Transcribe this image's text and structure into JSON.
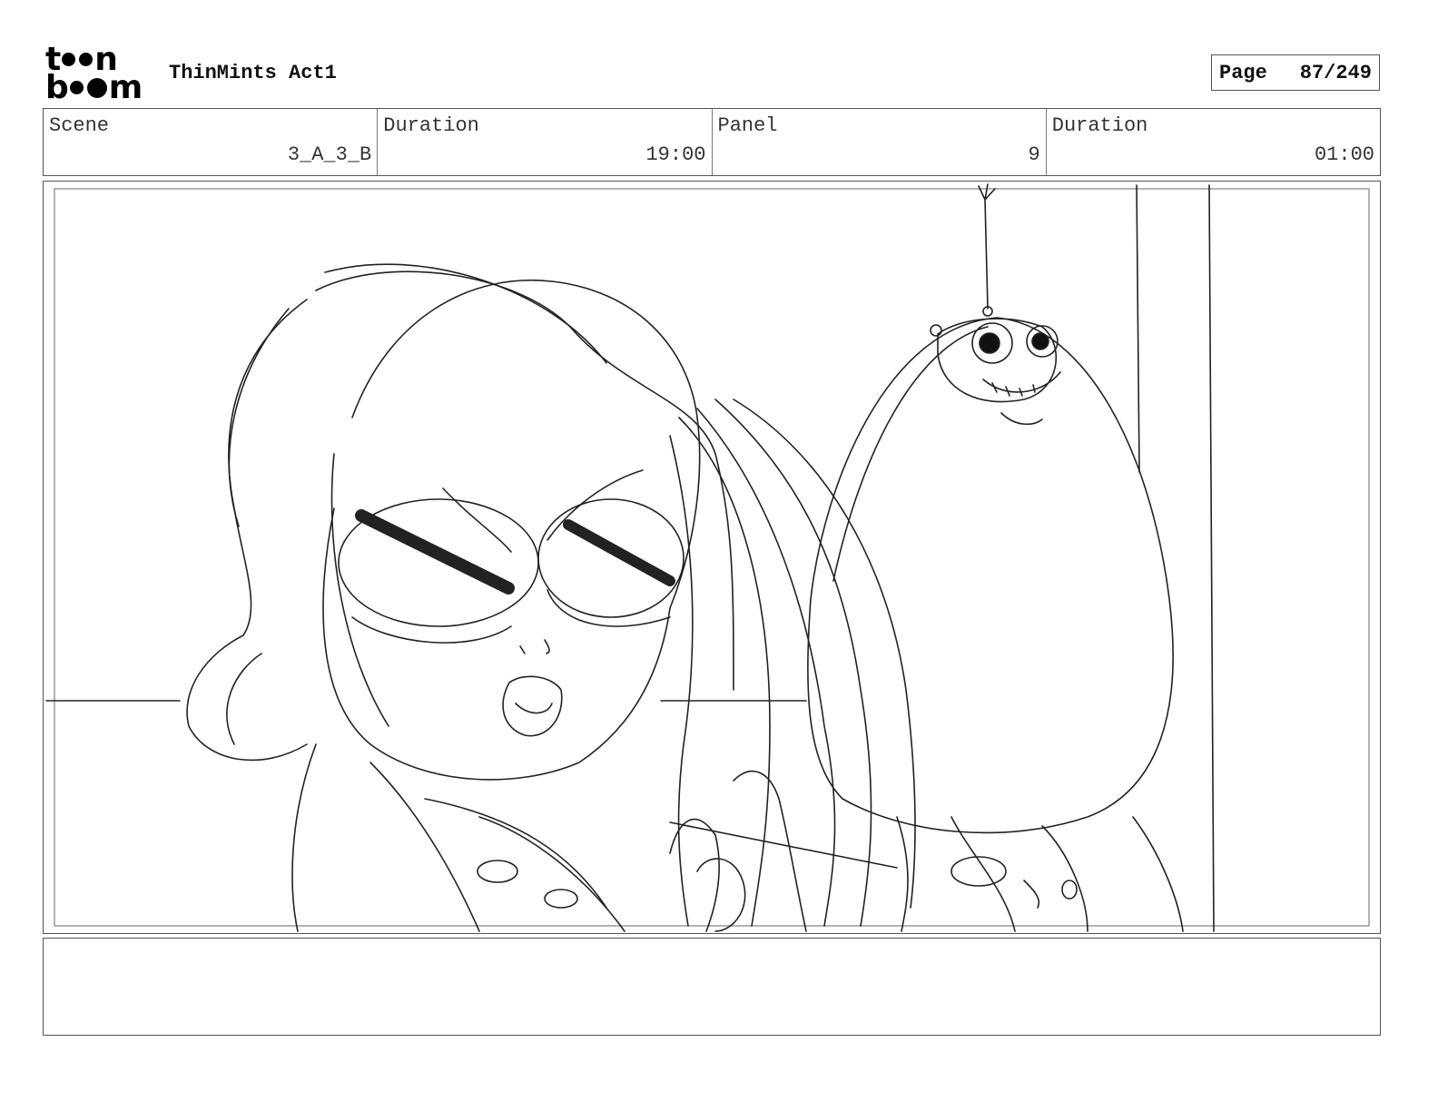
{
  "header": {
    "logo_top": "t",
    "logo_top_end": "n",
    "logo_bottom_start": "b",
    "logo_bottom_end": "m",
    "project_title": "ThinMints Act1",
    "page_label": "Page",
    "page_value": "87/249"
  },
  "info": [
    {
      "label": "Scene",
      "value": "3_A_3_B"
    },
    {
      "label": "Duration",
      "value": "19:00"
    },
    {
      "label": "Panel",
      "value": "9"
    },
    {
      "label": "Duration",
      "value": "01:00"
    }
  ],
  "notes": {
    "text": ""
  }
}
